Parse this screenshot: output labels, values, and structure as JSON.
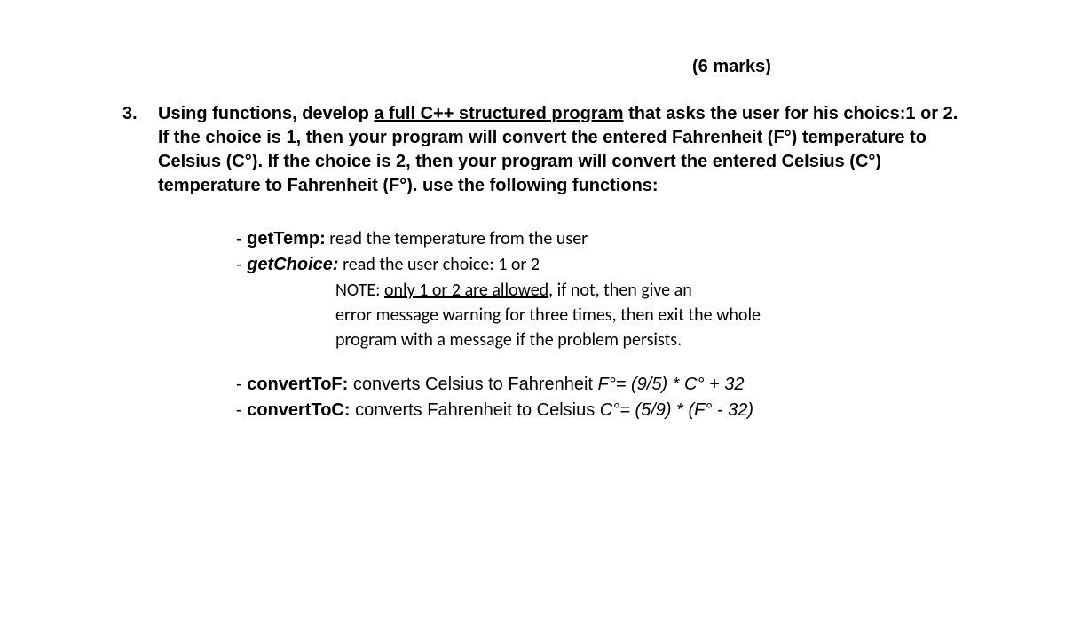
{
  "marks": "(6 marks)",
  "question_number": "3.",
  "question_html": "Using functions, develop <span class='underline'>a full C++ structured program</span> that asks the user for his choics:1 or 2. If the choice is 1, then your program will convert the entered Fahrenheit (F°) temperature to Celsius (C°). If the choice is 2, then your program will convert the entered Celsius (C°) temperature to Fahrenheit (F°). use the following functions:",
  "fn1": {
    "prefix": "- ",
    "name": "getTemp:",
    "desc": " read the temperature from the user"
  },
  "fn2": {
    "prefix": "- ",
    "name": "getChoice:",
    "desc": " read the user choice: 1 or 2"
  },
  "note": {
    "line1_a": "NOTE: ",
    "line1_b": "only 1 or 2 are allowed",
    "line1_c": ", if not, then give an",
    "line2": "error message warning for three times, then exit the whole",
    "line3": "program with a message if the problem persists."
  },
  "fn3": {
    "prefix": "- ",
    "name": "convertToF:",
    "desc": " converts Celsius to Fahrenheit  ",
    "formula": "F°= (9/5) * C° + 32"
  },
  "fn4": {
    "prefix": "- ",
    "name": "convertToC:",
    "desc": " converts Fahrenheit to Celsius  ",
    "formula": "C°= (5/9) * (F° - 32)"
  }
}
